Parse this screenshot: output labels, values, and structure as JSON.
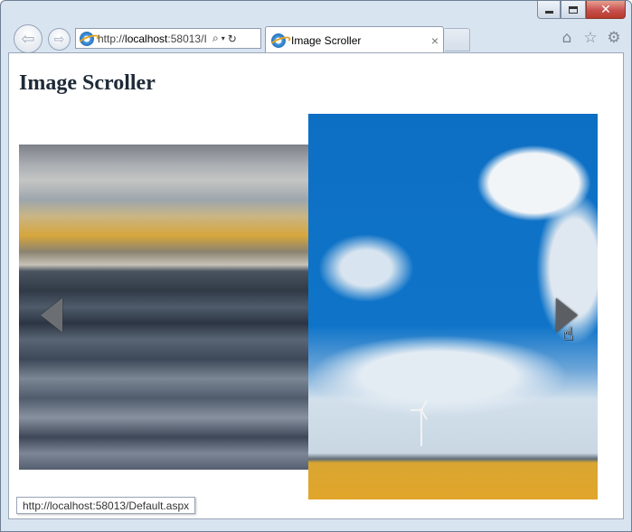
{
  "browser": {
    "address": {
      "prefix": "http://",
      "host": "localhost",
      "rest": ":58013/I"
    },
    "tab": {
      "title": "Image Scroller",
      "close": "×"
    },
    "window_buttons": {
      "close": "✕"
    }
  },
  "page": {
    "title": "Image Scroller",
    "images": [
      {
        "name": "sea-at-sunset"
      },
      {
        "name": "sky-with-wind-turbine"
      }
    ]
  },
  "status_bar": {
    "url": "http://localhost:58013/Default.aspx"
  }
}
